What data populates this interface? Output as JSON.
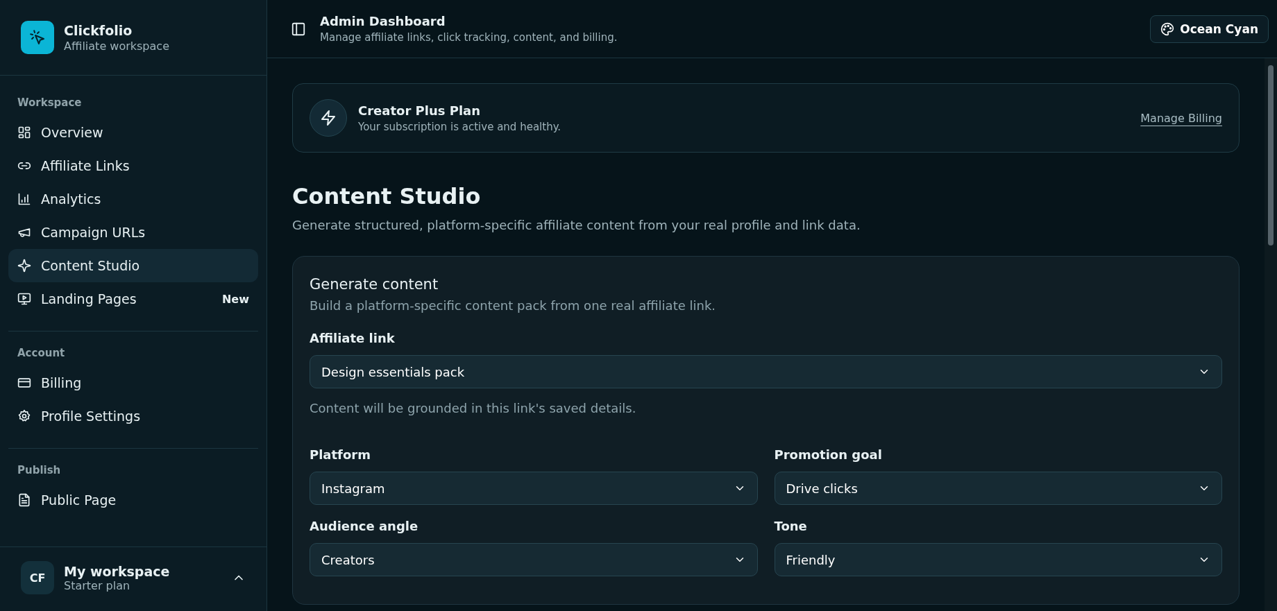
{
  "sidebar": {
    "brand": {
      "name": "Clickfolio",
      "subtitle": "Affiliate workspace"
    },
    "sections": [
      {
        "title": "Workspace",
        "items": [
          {
            "label": "Overview",
            "kind": "grid",
            "selected": false
          },
          {
            "label": "Affiliate Links",
            "kind": "link",
            "selected": false
          },
          {
            "label": "Analytics",
            "kind": "chart",
            "selected": false
          },
          {
            "label": "Campaign URLs",
            "kind": "megaphone",
            "selected": false
          },
          {
            "label": "Content Studio",
            "kind": "sparkles",
            "selected": true
          },
          {
            "label": "Landing Pages",
            "kind": "monitor",
            "selected": false,
            "badge": "New"
          }
        ]
      },
      {
        "title": "Account",
        "items": [
          {
            "label": "Billing",
            "kind": "card",
            "selected": false
          },
          {
            "label": "Profile Settings",
            "kind": "gear",
            "selected": false
          }
        ]
      },
      {
        "title": "Publish",
        "items": [
          {
            "label": "Public Page",
            "kind": "file",
            "selected": false
          }
        ]
      }
    ],
    "workspace": {
      "initials": "CF",
      "name": "My workspace",
      "plan": "Starter plan"
    }
  },
  "header": {
    "title": "Admin Dashboard",
    "subtitle": "Manage affiliate links, click tracking, content, and billing.",
    "theme_button": "Ocean Cyan"
  },
  "plan_banner": {
    "title": "Creator Plus Plan",
    "subtitle": "Your subscription is active and healthy.",
    "link": "Manage Billing"
  },
  "page": {
    "title": "Content Studio",
    "subtitle": "Generate structured, platform-specific affiliate content from your real profile and link data."
  },
  "form": {
    "title": "Generate content",
    "subtitle": "Build a platform-specific content pack from one real affiliate link.",
    "affiliate_link": {
      "label": "Affiliate link",
      "value": "Design essentials pack",
      "hint": "Content will be grounded in this link's saved details."
    },
    "fields": [
      {
        "label": "Platform",
        "value": "Instagram"
      },
      {
        "label": "Promotion goal",
        "value": "Drive clicks"
      },
      {
        "label": "Audience angle",
        "value": "Creators"
      },
      {
        "label": "Tone",
        "value": "Friendly"
      }
    ]
  }
}
